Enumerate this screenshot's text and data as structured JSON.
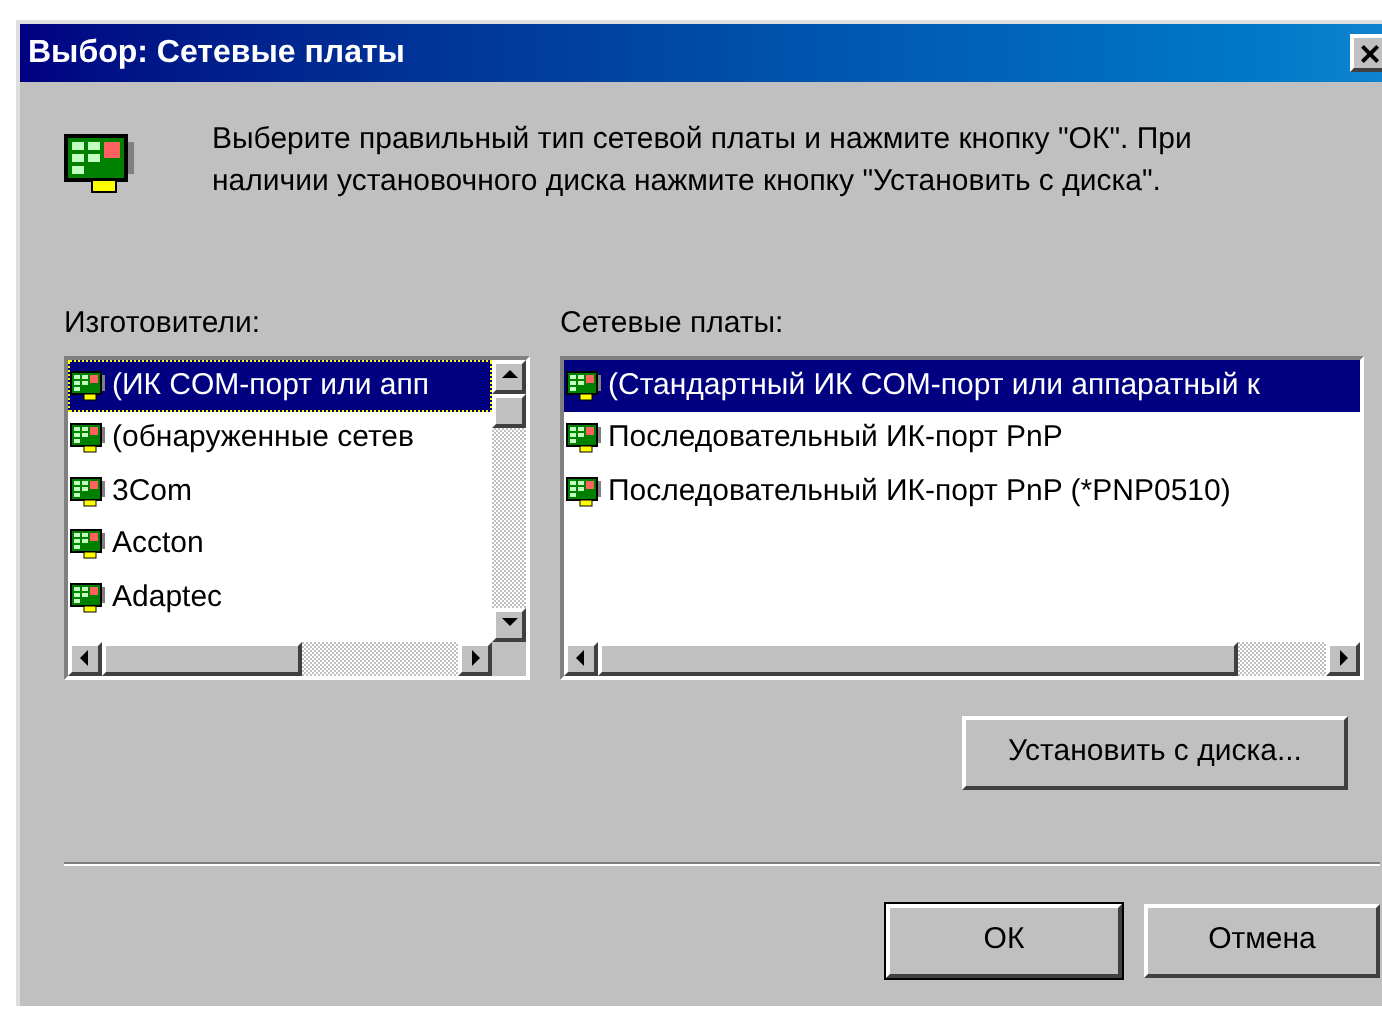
{
  "window": {
    "title": "Выбор: Сетевые платы",
    "close": "×"
  },
  "description": "Выберите правильный тип сетевой платы и нажмите кнопку \"ОК\". При наличии установочного диска нажмите кнопку \"Установить с диска\".",
  "manufacturers": {
    "label": "Изготовители:",
    "items": [
      {
        "text": "(ИК COM-порт или апп",
        "selected": true
      },
      {
        "text": "(обнаруженные сетев",
        "selected": false
      },
      {
        "text": "3Com",
        "selected": false
      },
      {
        "text": "Accton",
        "selected": false
      },
      {
        "text": "Adaptec",
        "selected": false
      }
    ]
  },
  "network_cards": {
    "label": "Сетевые платы:",
    "items": [
      {
        "text": "(Стандартный ИК COM-порт или аппаратный к",
        "selected": true
      },
      {
        "text": "Последовательный ИК-порт PnP",
        "selected": false
      },
      {
        "text": "Последовательный ИК-порт PnP (*PNP0510)",
        "selected": false
      }
    ]
  },
  "install_button": "Установить с диска...",
  "buttons": [
    {
      "label": "ОК",
      "default": true
    },
    {
      "label": "Отмена",
      "default": false
    }
  ]
}
